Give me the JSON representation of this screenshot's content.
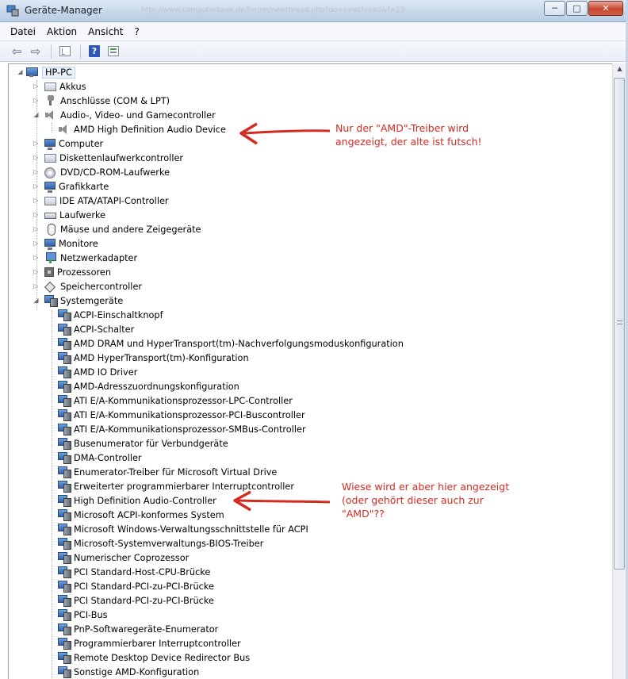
{
  "window": {
    "title": "Geräte-Manager",
    "ghost_url": "http://www.computerbase.de/forum/newthread.php?do=newthread&f=15",
    "minimize": "─",
    "maximize": "□",
    "close": "✕"
  },
  "menu": [
    "Datei",
    "Aktion",
    "Ansicht",
    "?"
  ],
  "toolbar": {
    "back": "⇦",
    "forward": "⇨",
    "help": "?"
  },
  "tree": {
    "root": "HP-PC",
    "expander_collapsed": "▷",
    "expander_expanded": "◢",
    "categories": [
      {
        "label": "Akkus",
        "icon": "battery-icon"
      },
      {
        "label": "Anschlüsse (COM & LPT)",
        "icon": "port-icon"
      },
      {
        "label": "Audio-, Video- und Gamecontroller",
        "icon": "speaker-icon",
        "expanded": true,
        "children": [
          {
            "label": "AMD High Definition Audio Device",
            "icon": "speaker-icon"
          }
        ]
      },
      {
        "label": "Computer",
        "icon": "computer-icon"
      },
      {
        "label": "Diskettenlaufwerkcontroller",
        "icon": "floppy-controller-icon"
      },
      {
        "label": "DVD/CD-ROM-Laufwerke",
        "icon": "disc-icon"
      },
      {
        "label": "Grafikkarte",
        "icon": "display-adapter-icon"
      },
      {
        "label": "IDE ATA/ATAPI-Controller",
        "icon": "ide-controller-icon"
      },
      {
        "label": "Laufwerke",
        "icon": "drive-icon"
      },
      {
        "label": "Mäuse und andere Zeigegeräte",
        "icon": "mouse-icon"
      },
      {
        "label": "Monitore",
        "icon": "monitor-icon"
      },
      {
        "label": "Netzwerkadapter",
        "icon": "network-adapter-icon"
      },
      {
        "label": "Prozessoren",
        "icon": "processor-icon"
      },
      {
        "label": "Speichercontroller",
        "icon": "storage-controller-icon"
      },
      {
        "label": "Systemgeräte",
        "icon": "system-device-icon",
        "expanded": true,
        "children": [
          {
            "label": "ACPI-Einschaltknopf"
          },
          {
            "label": "ACPI-Schalter"
          },
          {
            "label": "AMD DRAM und HyperTransport(tm)-Nachverfolgungsmoduskonfiguration"
          },
          {
            "label": "AMD HyperTransport(tm)-Konfiguration"
          },
          {
            "label": "AMD IO Driver"
          },
          {
            "label": "AMD-Adresszuordnungskonfiguration"
          },
          {
            "label": "ATI E/A-Kommunikationsprozessor-LPC-Controller"
          },
          {
            "label": "ATI E/A-Kommunikationsprozessor-PCI-Buscontroller"
          },
          {
            "label": "ATI E/A-Kommunikationsprozessor-SMBus-Controller"
          },
          {
            "label": "Busenumerator für Verbundgeräte"
          },
          {
            "label": "DMA-Controller"
          },
          {
            "label": "Enumerator-Treiber für Microsoft Virtual Drive"
          },
          {
            "label": "Erweiterter programmierbarer Interruptcontroller"
          },
          {
            "label": "High Definition Audio-Controller"
          },
          {
            "label": "Microsoft ACPI-konformes System"
          },
          {
            "label": "Microsoft Windows-Verwaltungsschnittstelle für ACPI"
          },
          {
            "label": "Microsoft-Systemverwaltungs-BIOS-Treiber"
          },
          {
            "label": "Numerischer Coprozessor"
          },
          {
            "label": "PCI Standard-Host-CPU-Brücke"
          },
          {
            "label": "PCI Standard-PCI-zu-PCI-Brücke"
          },
          {
            "label": "PCI Standard-PCI-zu-PCI-Brücke"
          },
          {
            "label": "PCI-Bus"
          },
          {
            "label": "PnP-Softwaregeräte-Enumerator"
          },
          {
            "label": "Programmierbarer Interruptcontroller"
          },
          {
            "label": "Remote Desktop Device Redirector Bus"
          },
          {
            "label": "Sonstige AMD-Konfiguration"
          }
        ]
      }
    ]
  },
  "annotations": [
    {
      "lines": [
        "Nur der \"AMD\"-Treiber wird",
        "angezeigt, der alte ist futsch!"
      ]
    },
    {
      "lines": [
        "Wiese wird er aber hier angezeigt",
        "(oder gehört dieser auch zur",
        "\"AMD\"??"
      ]
    }
  ],
  "colors": {
    "annotation": "#d42a1f",
    "selection": "#eaf3fb"
  }
}
